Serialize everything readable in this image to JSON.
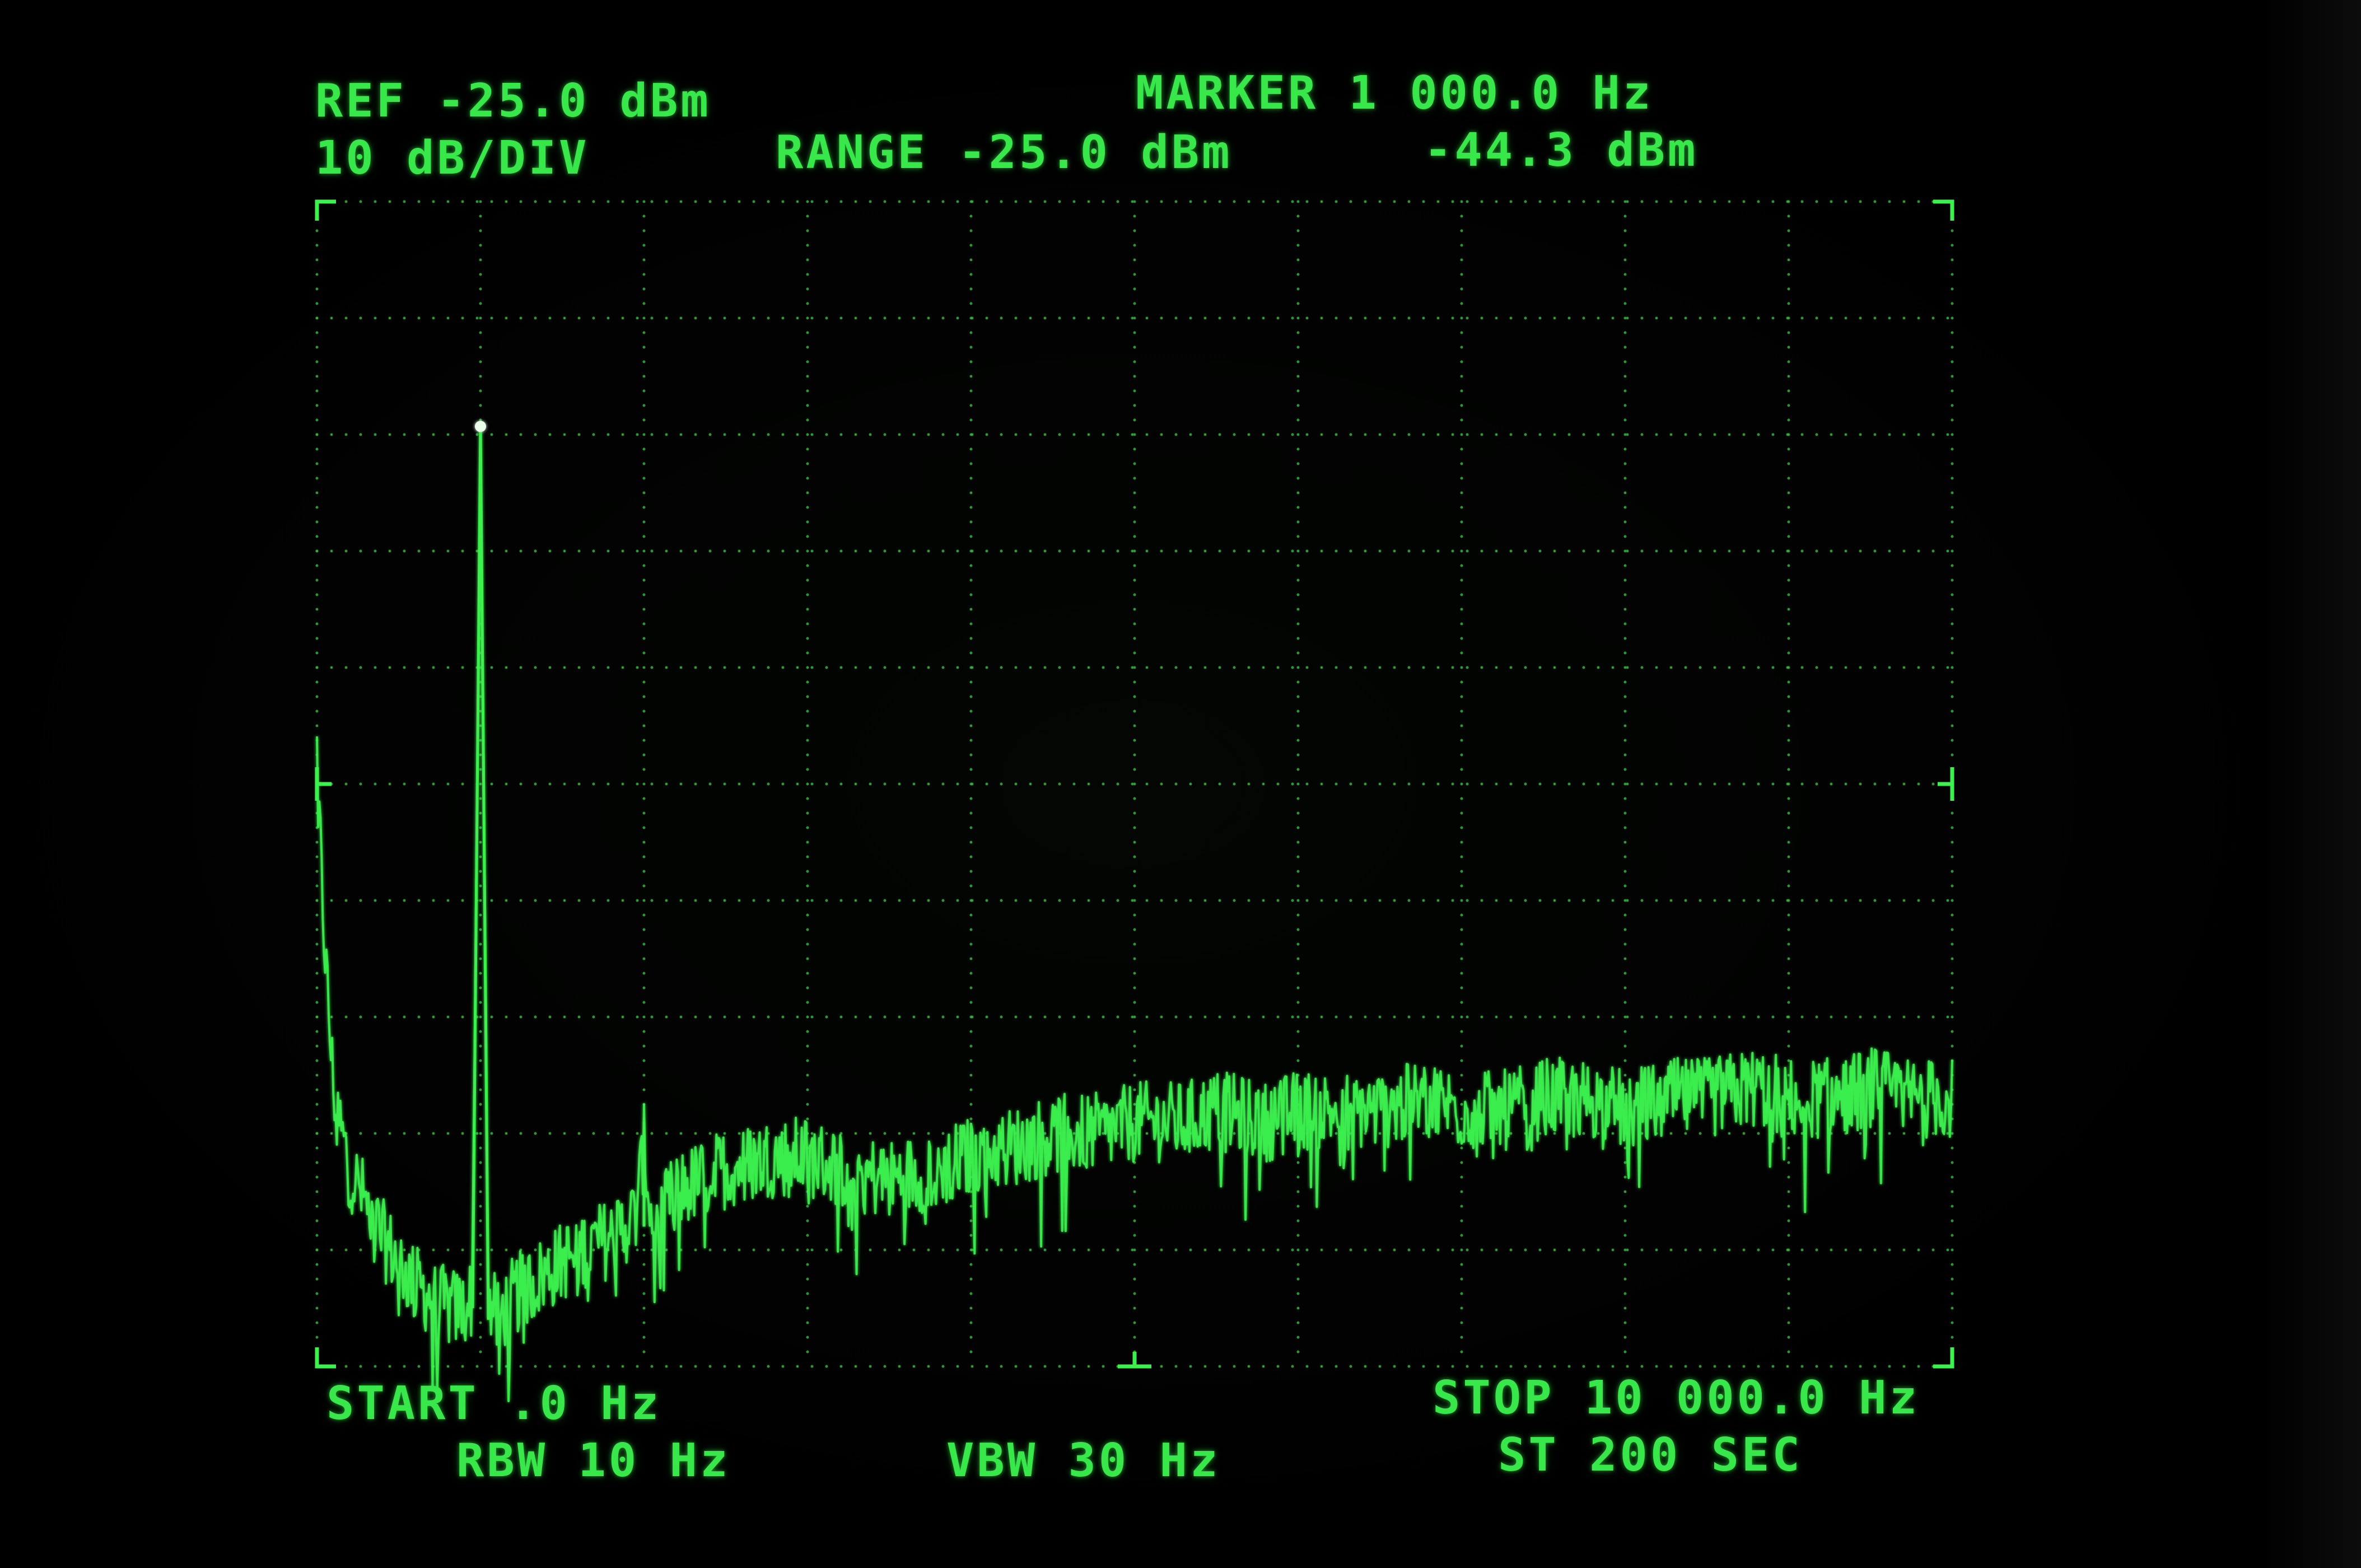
{
  "header": {
    "ref": "REF -25.0 dBm",
    "scale": "10 dB/DIV",
    "range": "RANGE -25.0 dBm",
    "marker_freq": "MARKER 1 000.0 Hz",
    "marker_level": "-44.3 dBm"
  },
  "footer": {
    "start": "START .0 Hz",
    "stop": "STOP 10 000.0 Hz",
    "rbw": "RBW 10 Hz",
    "vbw": "VBW 30 Hz",
    "sweep_time": "ST 200 SEC"
  },
  "colors": {
    "trace": "#3cf04e",
    "graticule": "#2fb83c",
    "background": "#000000"
  },
  "chart_data": {
    "type": "line",
    "title": "",
    "xlabel": "",
    "ylabel": "",
    "xlim": [
      0,
      10000
    ],
    "ylim": [
      -125,
      -25
    ],
    "grid": true,
    "marker": {
      "x": 1000,
      "y": -44.3
    },
    "series": [
      {
        "name": "",
        "x": [
          0,
          30,
          60,
          100,
          150,
          200,
          300,
          400,
          500,
          600,
          700,
          800,
          900,
          950,
          1000,
          1050,
          1100,
          1150,
          1200,
          1400,
          1600,
          1800,
          1950,
          2000,
          2050,
          2200,
          2500,
          2800,
          3000,
          3200,
          3500,
          3800,
          4000,
          4300,
          4500,
          4800,
          5000,
          5300,
          5500,
          5800,
          6000,
          6300,
          6500,
          6800,
          7000,
          7300,
          7500,
          7800,
          8000,
          8300,
          8500,
          8800,
          9000,
          9300,
          9500,
          9800,
          10000
        ],
        "y": [
          -72,
          -84,
          -92,
          -101,
          -105,
          -108,
          -111,
          -114,
          -116,
          -118,
          -119,
          -120,
          -120,
          -119,
          -44.3,
          -119,
          -121,
          -120,
          -119,
          -117,
          -115,
          -114,
          -112,
          -106,
          -113,
          -110,
          -108,
          -107,
          -107,
          -108,
          -109,
          -108,
          -107,
          -106,
          -105,
          -105,
          -104,
          -104,
          -103,
          -104,
          -103,
          -103,
          -103,
          -102,
          -103,
          -103,
          -102,
          -102,
          -103,
          -102,
          -102,
          -101,
          -102,
          -102,
          -101,
          -102,
          -102
        ]
      }
    ]
  }
}
